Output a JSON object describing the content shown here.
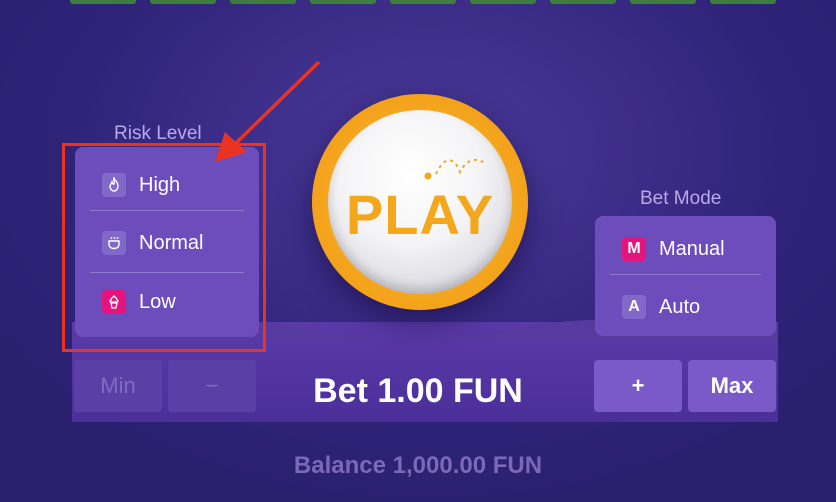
{
  "risk_level": {
    "label": "Risk Level",
    "options": [
      {
        "label": "High",
        "icon": "flame-icon"
      },
      {
        "label": "Normal",
        "icon": "cup-icon"
      },
      {
        "label": "Low",
        "icon": "cupcake-icon",
        "selected": true
      }
    ]
  },
  "play_button": {
    "label": "PLAY"
  },
  "bet_mode": {
    "label": "Bet Mode",
    "options": [
      {
        "label": "Manual",
        "icon_letter": "M",
        "selected": true
      },
      {
        "label": "Auto",
        "icon_letter": "A"
      }
    ]
  },
  "bet_controls": {
    "min_label": "Min",
    "minus_label": "−",
    "plus_label": "+",
    "max_label": "Max",
    "bet_text": "Bet 1.00 FUN"
  },
  "balance_text": "Balance 1,000.00 FUN",
  "colors": {
    "background": "#3a2b86",
    "panel": "#6d4cbc",
    "accent_pink": "#e4137e",
    "play_orange": "#f2a71c",
    "annotation_red": "#ea3323"
  }
}
